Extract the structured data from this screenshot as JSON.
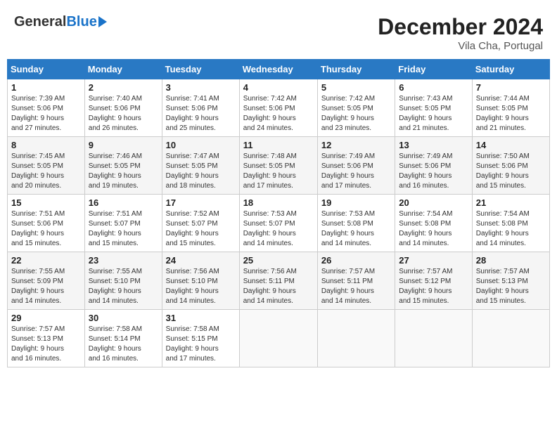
{
  "header": {
    "logo_line1": "General",
    "logo_line2": "Blue",
    "month": "December 2024",
    "location": "Vila Cha, Portugal"
  },
  "weekdays": [
    "Sunday",
    "Monday",
    "Tuesday",
    "Wednesday",
    "Thursday",
    "Friday",
    "Saturday"
  ],
  "weeks": [
    [
      {
        "day": "1",
        "info": "Sunrise: 7:39 AM\nSunset: 5:06 PM\nDaylight: 9 hours\nand 27 minutes."
      },
      {
        "day": "2",
        "info": "Sunrise: 7:40 AM\nSunset: 5:06 PM\nDaylight: 9 hours\nand 26 minutes."
      },
      {
        "day": "3",
        "info": "Sunrise: 7:41 AM\nSunset: 5:06 PM\nDaylight: 9 hours\nand 25 minutes."
      },
      {
        "day": "4",
        "info": "Sunrise: 7:42 AM\nSunset: 5:06 PM\nDaylight: 9 hours\nand 24 minutes."
      },
      {
        "day": "5",
        "info": "Sunrise: 7:42 AM\nSunset: 5:05 PM\nDaylight: 9 hours\nand 23 minutes."
      },
      {
        "day": "6",
        "info": "Sunrise: 7:43 AM\nSunset: 5:05 PM\nDaylight: 9 hours\nand 21 minutes."
      },
      {
        "day": "7",
        "info": "Sunrise: 7:44 AM\nSunset: 5:05 PM\nDaylight: 9 hours\nand 21 minutes."
      }
    ],
    [
      {
        "day": "8",
        "info": "Sunrise: 7:45 AM\nSunset: 5:05 PM\nDaylight: 9 hours\nand 20 minutes."
      },
      {
        "day": "9",
        "info": "Sunrise: 7:46 AM\nSunset: 5:05 PM\nDaylight: 9 hours\nand 19 minutes."
      },
      {
        "day": "10",
        "info": "Sunrise: 7:47 AM\nSunset: 5:05 PM\nDaylight: 9 hours\nand 18 minutes."
      },
      {
        "day": "11",
        "info": "Sunrise: 7:48 AM\nSunset: 5:05 PM\nDaylight: 9 hours\nand 17 minutes."
      },
      {
        "day": "12",
        "info": "Sunrise: 7:49 AM\nSunset: 5:06 PM\nDaylight: 9 hours\nand 17 minutes."
      },
      {
        "day": "13",
        "info": "Sunrise: 7:49 AM\nSunset: 5:06 PM\nDaylight: 9 hours\nand 16 minutes."
      },
      {
        "day": "14",
        "info": "Sunrise: 7:50 AM\nSunset: 5:06 PM\nDaylight: 9 hours\nand 15 minutes."
      }
    ],
    [
      {
        "day": "15",
        "info": "Sunrise: 7:51 AM\nSunset: 5:06 PM\nDaylight: 9 hours\nand 15 minutes."
      },
      {
        "day": "16",
        "info": "Sunrise: 7:51 AM\nSunset: 5:07 PM\nDaylight: 9 hours\nand 15 minutes."
      },
      {
        "day": "17",
        "info": "Sunrise: 7:52 AM\nSunset: 5:07 PM\nDaylight: 9 hours\nand 15 minutes."
      },
      {
        "day": "18",
        "info": "Sunrise: 7:53 AM\nSunset: 5:07 PM\nDaylight: 9 hours\nand 14 minutes."
      },
      {
        "day": "19",
        "info": "Sunrise: 7:53 AM\nSunset: 5:08 PM\nDaylight: 9 hours\nand 14 minutes."
      },
      {
        "day": "20",
        "info": "Sunrise: 7:54 AM\nSunset: 5:08 PM\nDaylight: 9 hours\nand 14 minutes."
      },
      {
        "day": "21",
        "info": "Sunrise: 7:54 AM\nSunset: 5:08 PM\nDaylight: 9 hours\nand 14 minutes."
      }
    ],
    [
      {
        "day": "22",
        "info": "Sunrise: 7:55 AM\nSunset: 5:09 PM\nDaylight: 9 hours\nand 14 minutes."
      },
      {
        "day": "23",
        "info": "Sunrise: 7:55 AM\nSunset: 5:10 PM\nDaylight: 9 hours\nand 14 minutes."
      },
      {
        "day": "24",
        "info": "Sunrise: 7:56 AM\nSunset: 5:10 PM\nDaylight: 9 hours\nand 14 minutes."
      },
      {
        "day": "25",
        "info": "Sunrise: 7:56 AM\nSunset: 5:11 PM\nDaylight: 9 hours\nand 14 minutes."
      },
      {
        "day": "26",
        "info": "Sunrise: 7:57 AM\nSunset: 5:11 PM\nDaylight: 9 hours\nand 14 minutes."
      },
      {
        "day": "27",
        "info": "Sunrise: 7:57 AM\nSunset: 5:12 PM\nDaylight: 9 hours\nand 15 minutes."
      },
      {
        "day": "28",
        "info": "Sunrise: 7:57 AM\nSunset: 5:13 PM\nDaylight: 9 hours\nand 15 minutes."
      }
    ],
    [
      {
        "day": "29",
        "info": "Sunrise: 7:57 AM\nSunset: 5:13 PM\nDaylight: 9 hours\nand 16 minutes."
      },
      {
        "day": "30",
        "info": "Sunrise: 7:58 AM\nSunset: 5:14 PM\nDaylight: 9 hours\nand 16 minutes."
      },
      {
        "day": "31",
        "info": "Sunrise: 7:58 AM\nSunset: 5:15 PM\nDaylight: 9 hours\nand 17 minutes."
      },
      {
        "day": "",
        "info": ""
      },
      {
        "day": "",
        "info": ""
      },
      {
        "day": "",
        "info": ""
      },
      {
        "day": "",
        "info": ""
      }
    ]
  ]
}
